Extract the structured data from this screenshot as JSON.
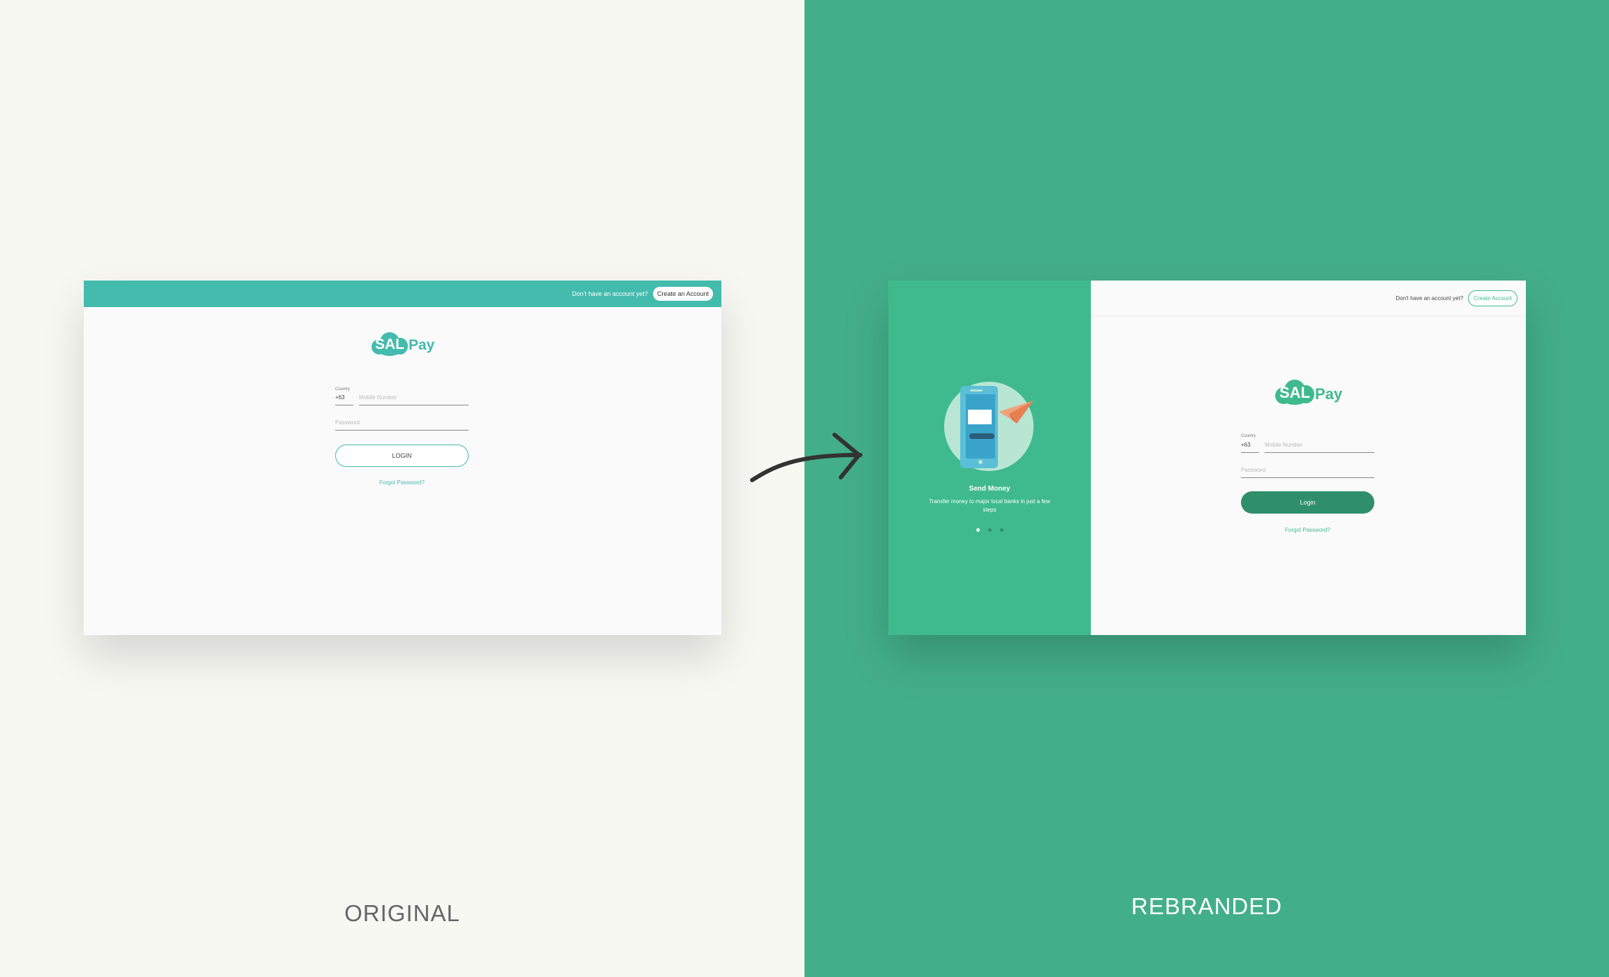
{
  "captions": {
    "left": "ORIGINAL",
    "right": "REBRANDED"
  },
  "original": {
    "topbar": {
      "prompt": "Don't have an account yet?",
      "create_button": "Create an Account"
    },
    "logo": {
      "mark": "SAL",
      "word": "Pay"
    },
    "form": {
      "country_label": "Country",
      "country_code": "+63",
      "mobile_placeholder": "Mobile Number",
      "password_placeholder": "Password",
      "login_button": "LOGIN",
      "forgot_link": "Forgot Password?"
    },
    "accent_color": "#43bbad"
  },
  "rebranded": {
    "header": {
      "prompt": "Don't have an account yet?",
      "create_button": "Create Account"
    },
    "logo": {
      "mark": "SAL",
      "word": "Pay"
    },
    "slide": {
      "title": "Send Money",
      "description": "Transfer money to major local banks in just a few steps",
      "dots": 3,
      "active_dot": 1
    },
    "form": {
      "country_label": "Country",
      "country_code": "+63",
      "mobile_placeholder": "Mobile Number",
      "password_placeholder": "Password",
      "login_button": "Login",
      "forgot_link": "Forgot Password?"
    },
    "accent_color": "#3fba8e"
  },
  "colors": {
    "left_background": "#f8f8f3",
    "right_background": "#43af8a"
  }
}
